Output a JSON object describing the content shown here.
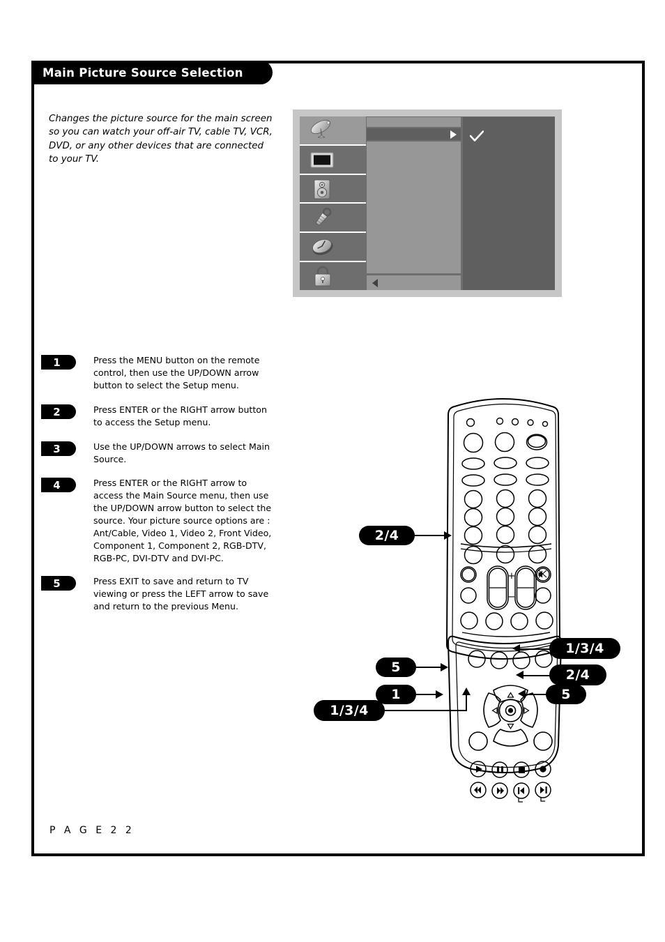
{
  "page": {
    "title": "Main Picture Source Selection",
    "footer": "P A G E   2 2",
    "intro": "Changes the picture source for the main screen so you can watch your off-air TV, cable TV, VCR, DVD, or any other devices that are connected to your TV."
  },
  "osd": {
    "tabs": [
      {
        "icon": "satellite-dish-icon",
        "selected": true
      },
      {
        "icon": "tv-screen-icon",
        "selected": false
      },
      {
        "icon": "speaker-icon",
        "selected": false
      },
      {
        "icon": "wrench-setup-icon",
        "selected": false
      },
      {
        "icon": "clock-timer-icon",
        "selected": false
      },
      {
        "icon": "padlock-icon",
        "selected": false
      }
    ],
    "rows": [
      {
        "type": "plain",
        "label": ""
      },
      {
        "type": "highlight",
        "label": "",
        "marker": "triangle-right-icon"
      }
    ],
    "back_row": {
      "marker": "triangle-left-icon"
    },
    "right_panel": {
      "marker": "checkmark-icon"
    },
    "colors": {
      "bezel": "#c6c6c6",
      "tab_normal": "#6e6e6e",
      "tab_selected": "#9a9a9a",
      "row": "#979797",
      "row_highlight": "#5f5f5f",
      "panel": "#5f5f5f"
    }
  },
  "steps": [
    {
      "number": "1",
      "text": "Press the MENU button on the remote control, then use the UP/DOWN arrow button to select the Setup menu."
    },
    {
      "number": "2",
      "text": "Press ENTER or the RIGHT arrow button to access the Setup menu."
    },
    {
      "number": "3",
      "text": "Use the UP/DOWN arrows to select Main Source."
    },
    {
      "number": "4",
      "text": "Press ENTER or the RIGHT arrow to access the Main Source menu, then use the UP/DOWN arrow button to select the source. Your picture source options are : Ant/Cable, Video 1, Video 2, Front Video, Component 1, Component 2, RGB-DTV, RGB-PC, DVI-DTV and DVI-PC."
    },
    {
      "number": "5",
      "text": "Press EXIT to save and return to TV viewing or press the LEFT arrow to save and return to the previous Menu."
    }
  ],
  "callouts": [
    {
      "id": "menu-button-callout",
      "label": "2/4",
      "target": "menu-button"
    },
    {
      "id": "up-arrow-callout",
      "label": "1/3/4",
      "target": "up-arrow-button"
    },
    {
      "id": "left-arrow-callout",
      "label": "5",
      "target": "left-arrow-button"
    },
    {
      "id": "right-arrow-callout",
      "label": "2/4",
      "target": "right-arrow-button"
    },
    {
      "id": "exit-button-callout",
      "label": "1",
      "target": "exit-button"
    },
    {
      "id": "enter-button-callout",
      "label": "5",
      "target": "enter-button"
    },
    {
      "id": "down-arrow-callout",
      "label": "1/3/4",
      "target": "down-arrow-button"
    }
  ],
  "remote": {
    "rocker_plus": "+",
    "rocker_minus": "−",
    "mute_icon": "mute-icon",
    "transport_top": [
      "play-icon",
      "pause-icon",
      "stop-icon",
      "record-icon"
    ],
    "transport_bottom": [
      "rewind-icon",
      "fast-forward-icon",
      "skip-back-icon",
      "skip-forward-icon"
    ]
  }
}
